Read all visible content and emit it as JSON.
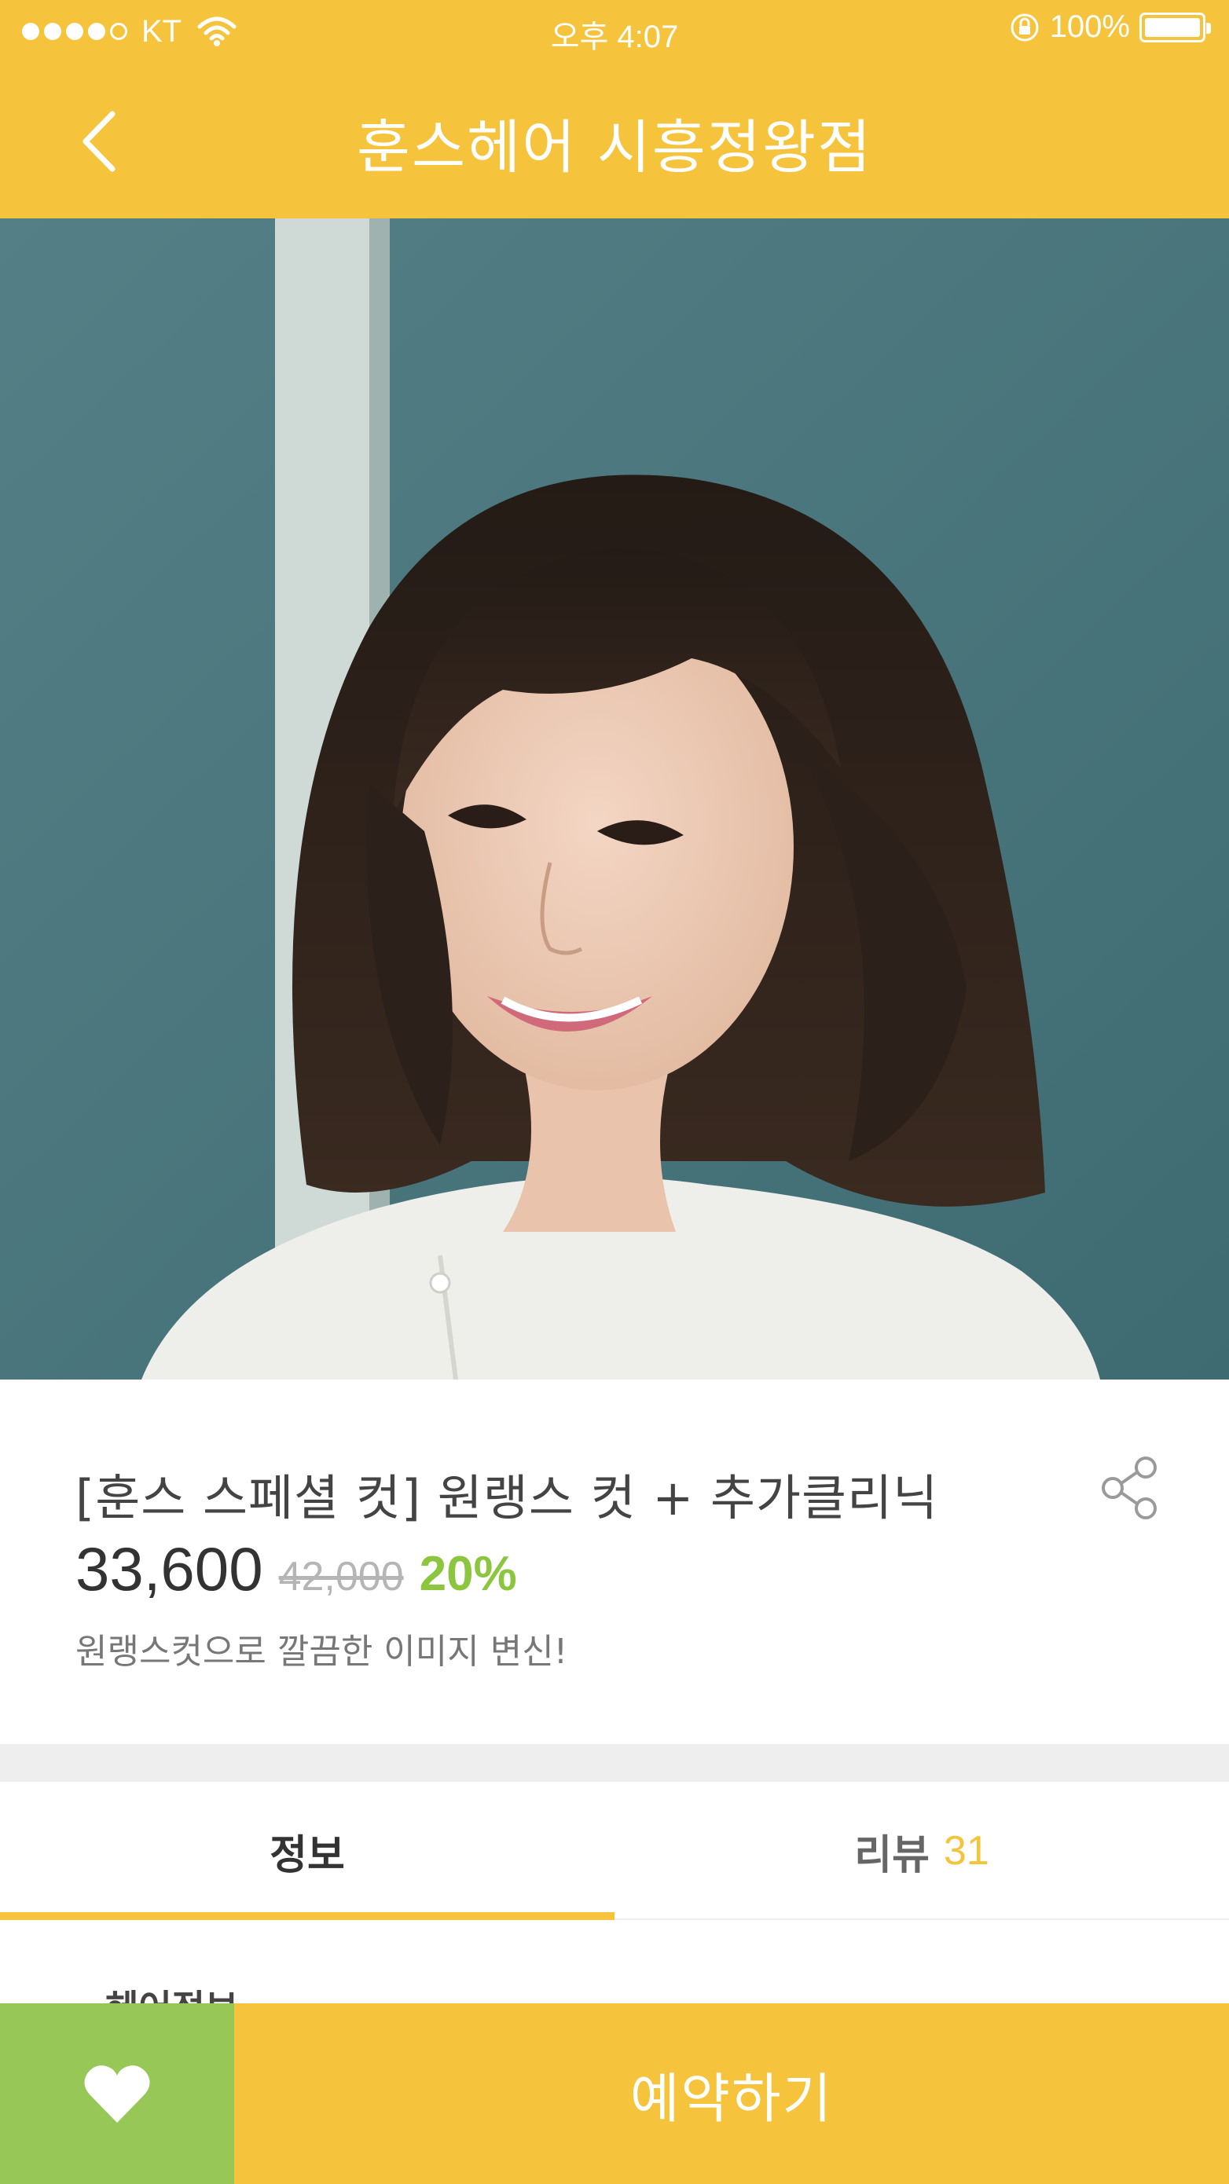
{
  "status_bar": {
    "carrier": "KT",
    "time": "오후 4:07",
    "battery": "100%",
    "signal_icon": "signal-dots-icon",
    "wifi_icon": "wifi-icon",
    "lock_icon": "rotation-lock-icon",
    "battery_icon": "battery-icon"
  },
  "nav": {
    "back_icon": "chevron-left-icon",
    "title": "훈스헤어 시흥정왕점"
  },
  "product": {
    "title": "[훈스 스페셜 컷] 원랭스 컷 + 추가클리닉",
    "price": "33,600",
    "original_price": "42,000",
    "discount": "20%",
    "subtitle": "원랭스컷으로 깔끔한 이미지 변신!",
    "share_icon": "share-icon"
  },
  "tabs": [
    {
      "label": "정보",
      "active": true
    },
    {
      "label": "리뷰",
      "count": "31",
      "active": false
    }
  ],
  "section_peek": "헤어정보",
  "bottom_bar": {
    "like_icon": "heart-icon",
    "reserve_label": "예약하기"
  },
  "colors": {
    "brand_yellow": "#f5c43c",
    "like_green": "#96c757",
    "discount_green": "#8cc63f"
  }
}
